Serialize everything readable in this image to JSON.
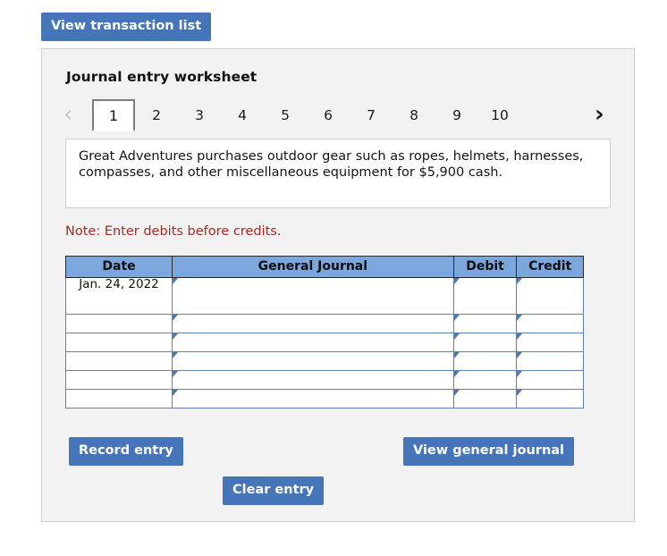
{
  "top_action": {
    "view_transaction_list_label": "View transaction list"
  },
  "panel": {
    "title": "Journal entry worksheet",
    "pager": {
      "prev_icon": "‹",
      "next_icon": "›",
      "tabs": [
        {
          "label": "1",
          "active": true
        },
        {
          "label": "2",
          "active": false
        },
        {
          "label": "3",
          "active": false
        },
        {
          "label": "4",
          "active": false
        },
        {
          "label": "5",
          "active": false
        },
        {
          "label": "6",
          "active": false
        },
        {
          "label": "7",
          "active": false
        },
        {
          "label": "8",
          "active": false
        },
        {
          "label": "9",
          "active": false
        },
        {
          "label": "10",
          "active": false
        }
      ]
    },
    "description": "Great Adventures purchases outdoor gear such as ropes, helmets, harnesses, compasses, and other miscellaneous equipment for $5,900 cash.",
    "note": "Note: Enter debits before credits.",
    "table": {
      "headers": {
        "date": "Date",
        "general_journal": "General Journal",
        "debit": "Debit",
        "credit": "Credit"
      },
      "rows": [
        {
          "date": "Jan. 24, 2022",
          "general_journal": "",
          "debit": "",
          "credit": ""
        },
        {
          "date": "",
          "general_journal": "",
          "debit": "",
          "credit": ""
        },
        {
          "date": "",
          "general_journal": "",
          "debit": "",
          "credit": ""
        },
        {
          "date": "",
          "general_journal": "",
          "debit": "",
          "credit": ""
        },
        {
          "date": "",
          "general_journal": "",
          "debit": "",
          "credit": ""
        },
        {
          "date": "",
          "general_journal": "",
          "debit": "",
          "credit": ""
        }
      ]
    },
    "buttons": {
      "record_entry": "Record entry",
      "view_general_journal": "View general journal",
      "clear_entry": "Clear entry"
    }
  },
  "colors": {
    "button_blue": "#4674b8",
    "table_header_blue": "#7ba7dc",
    "note_red": "#a32b23",
    "panel_background": "#f2f2f2",
    "input_cell_border": "#5e82ad"
  }
}
